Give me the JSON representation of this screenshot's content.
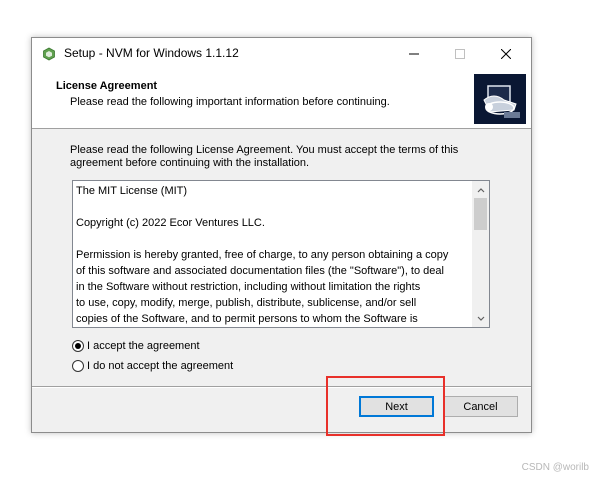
{
  "window": {
    "title": "Setup - NVM for Windows 1.1.12"
  },
  "header": {
    "title": "License Agreement",
    "subtitle": "Please read the following important information before continuing."
  },
  "intro": "Please read the following License Agreement. You must accept the terms of this agreement before continuing with the installation.",
  "license": {
    "line1": "The MIT License (MIT)",
    "line2": "Copyright (c) 2022 Ecor Ventures LLC.",
    "line3": "Permission is hereby granted, free of charge, to any person obtaining a copy",
    "line4": "of this software and associated documentation files (the \"Software\"), to deal",
    "line5": "in the Software without restriction, including without limitation the rights",
    "line6": "to use, copy, modify, merge, publish, distribute, sublicense, and/or sell",
    "line7": "copies of the Software, and to permit persons to whom the Software is"
  },
  "options": {
    "accept": "I accept the agreement",
    "decline": "I do not accept the agreement",
    "selected": "accept"
  },
  "buttons": {
    "next": "Next",
    "cancel": "Cancel"
  },
  "watermark": "CSDN @worilb",
  "colors": {
    "highlight": "#e8302a",
    "default_button_border": "#0078d7"
  }
}
